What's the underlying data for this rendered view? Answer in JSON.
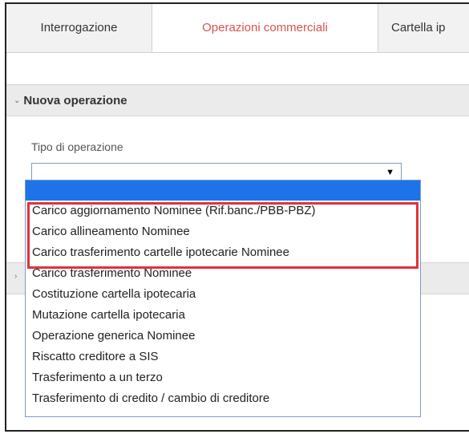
{
  "tabs": [
    {
      "label": "Interrogazione"
    },
    {
      "label": "Operazioni commerciali"
    },
    {
      "label": "Cartella ip"
    }
  ],
  "section": {
    "title": "Nuova operazione"
  },
  "form": {
    "type_label": "Tipo di operazione",
    "type_value": ""
  },
  "dropdown": {
    "options": [
      "",
      "Carico aggiornamento Nominee (Rif.banc./PBB-PBZ)",
      "Carico allineamento Nominee",
      "Carico trasferimento cartelle ipotecarie Nominee",
      "Carico trasferimento Nominee",
      "Costituzione cartella ipotecaria",
      "Mutazione cartella ipotecaria",
      "Operazione generica Nominee",
      "Riscatto creditore a SIS",
      "Trasferimento a un terzo",
      "Trasferimento di credito / cambio di creditore"
    ]
  },
  "colors": {
    "active_tab": "#d9534f",
    "selected_option": "#1e73e8",
    "highlight": "#e0323c"
  }
}
